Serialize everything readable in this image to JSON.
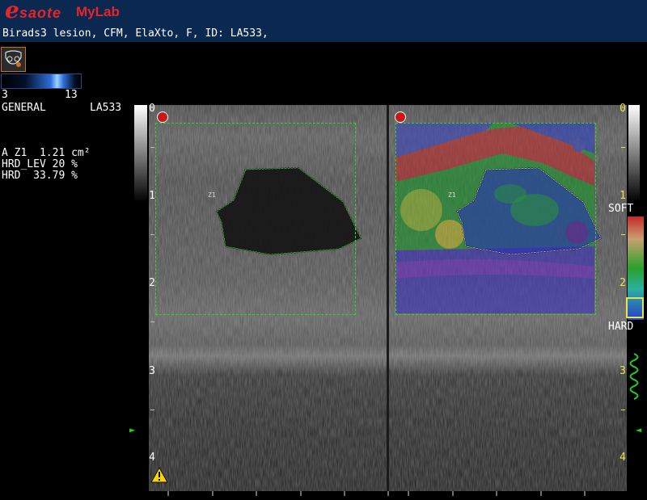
{
  "brand": {
    "e_letter": "e",
    "rest": "saote",
    "product": "MyLab"
  },
  "header": {
    "patient_line": "Birads3 lesion, CFM, ElaXto, F, ID: LA533,"
  },
  "colorbar": {
    "min": "3",
    "max": "13"
  },
  "preset": {
    "name": "GENERAL",
    "id": "LA533"
  },
  "measurements": [
    {
      "label": "A Z1",
      "value": "1.21 cm²"
    },
    {
      "label": "HRD_LEV",
      "value": "20 %"
    },
    {
      "label": "HRD",
      "value": "33.79 %"
    }
  ],
  "left_image": {
    "depth_marks": [
      "0",
      "1",
      "2",
      "3",
      "4"
    ],
    "lesion_label": "Z1"
  },
  "right_image": {
    "depth_marks": [
      "0",
      "1",
      "2",
      "3",
      "4"
    ],
    "lesion_label": "Z1"
  },
  "elasto_scale": {
    "soft": "SOFT",
    "hard": "HARD"
  },
  "colors": {
    "header_bg": "#0b2850",
    "brand_red": "#e4262b",
    "roi_green": "#2ad82a",
    "depth_yellow": "#e8e44a",
    "warning_yellow": "#f5d20a"
  },
  "icons": [
    "esaote-logo-icon",
    "breast-body-marker-icon",
    "warning-icon",
    "focus-marker-icon",
    "green-wave-icon"
  ]
}
